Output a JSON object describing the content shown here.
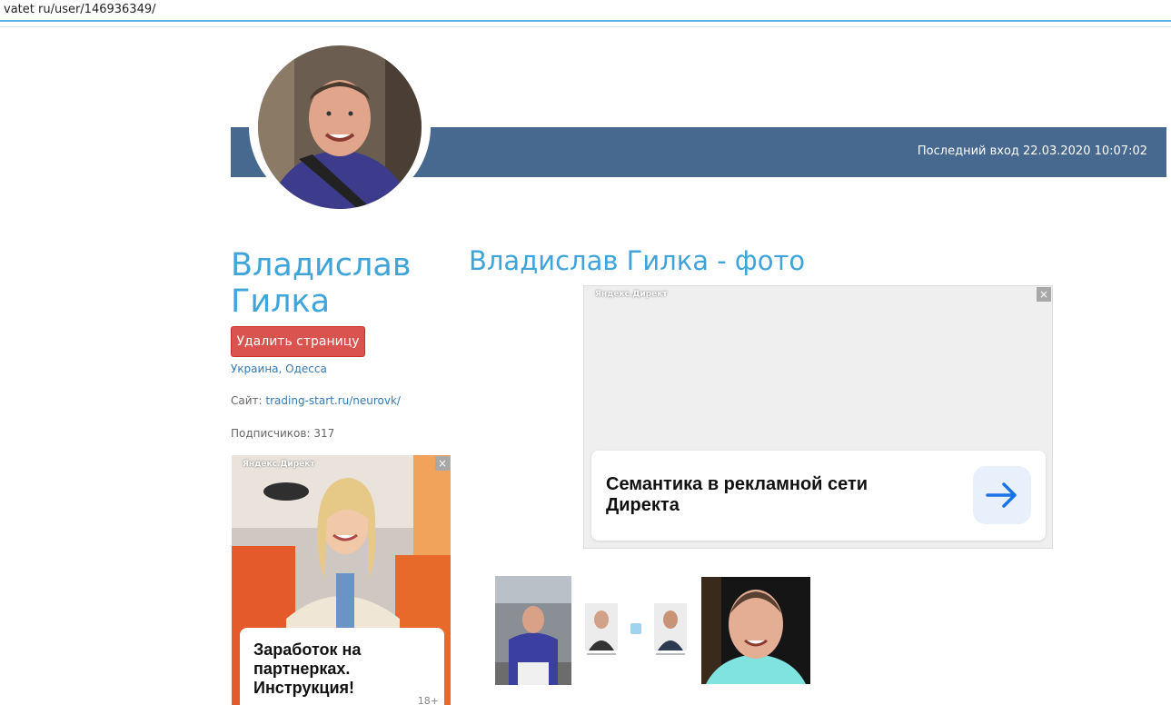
{
  "browser": {
    "url": "vatet ru/user/146936349/"
  },
  "profile": {
    "last_login": "Последний вход 22.03.2020 10:07:02",
    "name": "Владислав Гилка",
    "delete_button": "Удалить страницу",
    "location": "Украина, Одесса",
    "site_label": "Сайт:",
    "site_url": "trading-start.ru/neurovk/",
    "subscribers": "Подписчиков: 317"
  },
  "photos": {
    "heading": "Владислав Гилка - фото",
    "items": [
      "photo-1",
      "photo-2",
      "photo-3",
      "photo-4"
    ]
  },
  "ads": {
    "right": {
      "label": "Яндекс.Директ",
      "close": "×",
      "title": "Семантика в рекламной сети Директа"
    },
    "left": {
      "label": "Яндекс.Директ",
      "close": "×",
      "title": "Заработок на партнерках. Инструкция!",
      "age": "18+"
    }
  },
  "colors": {
    "accent": "#3fa4d9",
    "cover": "#47688f",
    "danger": "#d9534f",
    "link": "#337ab7"
  }
}
